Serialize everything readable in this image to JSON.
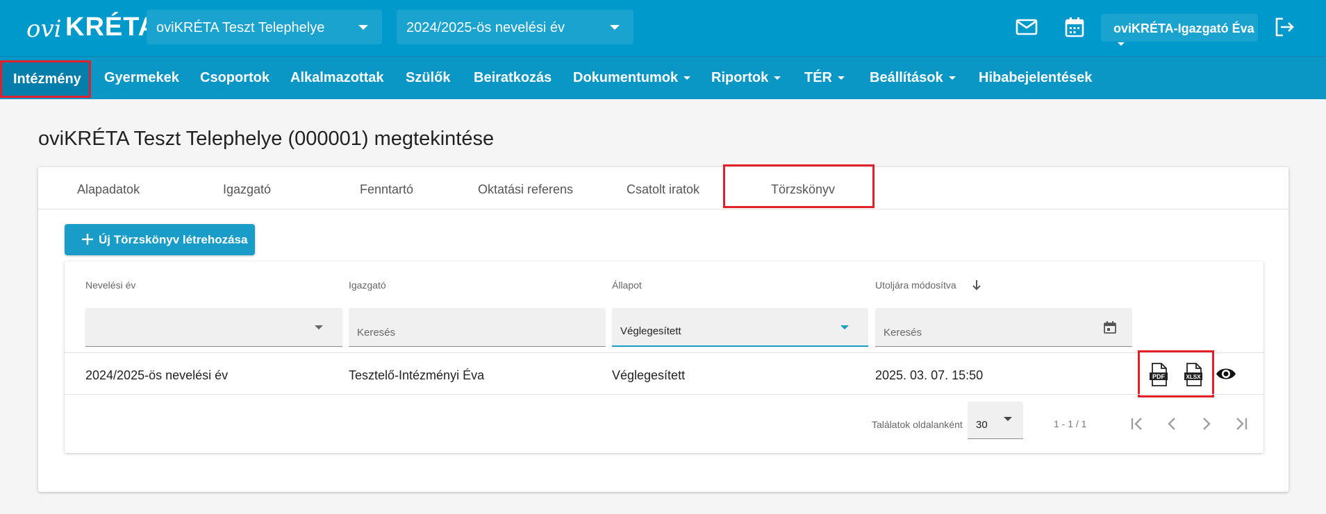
{
  "header": {
    "logo_prefix": "ovi",
    "logo_main": "KRÉTA",
    "site_select": "oviKRÉTA Teszt Telephelye",
    "year_select": "2024/2025-ös nevelési év",
    "user": "oviKRÉTA-Igazgató Éva"
  },
  "nav": {
    "items": [
      "Intézmény",
      "Gyermekek",
      "Csoportok",
      "Alkalmazottak",
      "Szülők",
      "Beiratkozás",
      "Dokumentumok",
      "Riportok",
      "TÉR",
      "Beállítások",
      "Hibabejelentések"
    ]
  },
  "page": {
    "title": "oviKRÉTA Teszt Telephelye (000001) megtekintése"
  },
  "tabs": [
    "Alapadatok",
    "Igazgató",
    "Fenntartó",
    "Oktatási referens",
    "Csatolt iratok",
    "Törzskönyv"
  ],
  "actions": {
    "new_label": "Új Törzskönyv létrehozása"
  },
  "grid": {
    "columns": [
      "Nevelési év",
      "Igazgató",
      "Állapot",
      "Utoljára módosítva"
    ],
    "filters": {
      "search_placeholder": "Keresés",
      "status_value": "Véglegesített"
    },
    "rows": [
      {
        "year": "2024/2025-ös nevelési év",
        "director": "Tesztelő-Intézményi Éva",
        "status": "Véglegesített",
        "modified": "2025. 03. 07. 15:50"
      }
    ],
    "icons": {
      "pdf": "PDF",
      "xlsx": "XLSX"
    },
    "footer": {
      "per_page_label": "Találatok oldalanként",
      "per_page": "30",
      "range": "1 - 1 / 1"
    }
  },
  "colors": {
    "header_bg": "#0099cc",
    "highlight": "#e32028",
    "button": "#1a9cc9"
  }
}
